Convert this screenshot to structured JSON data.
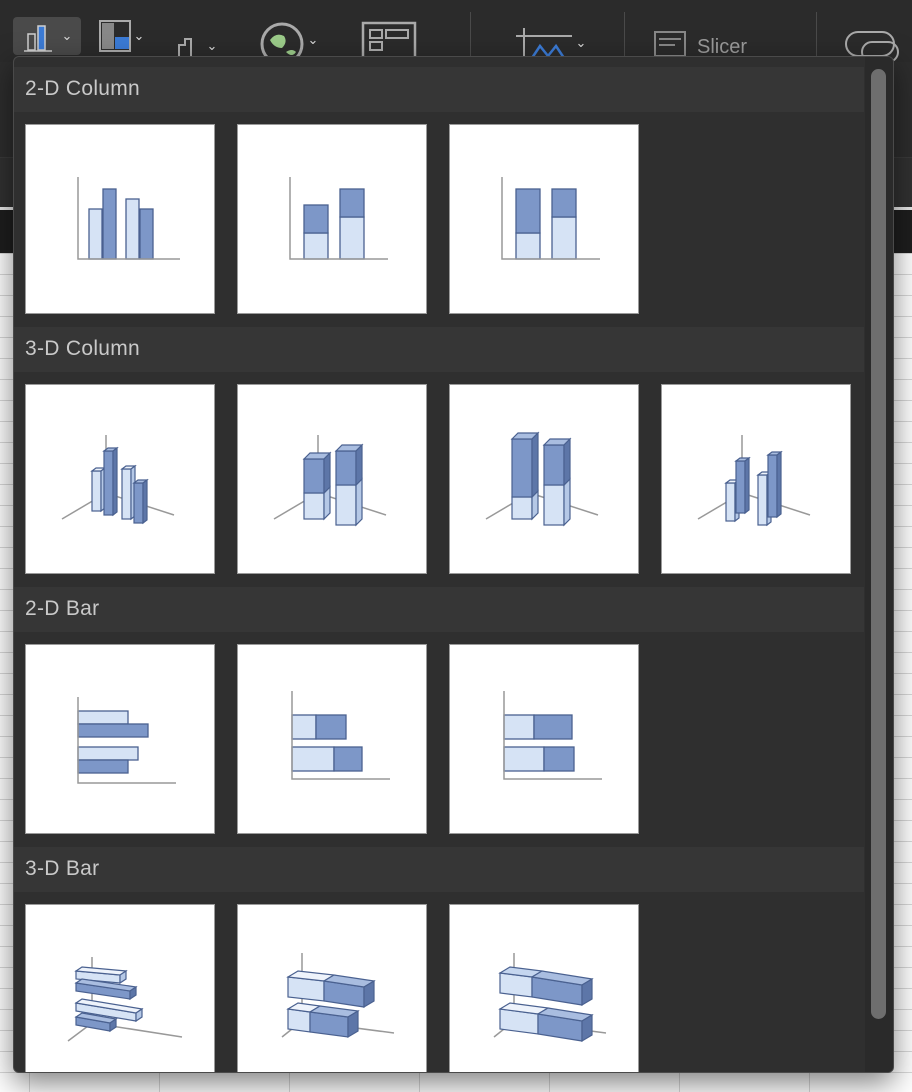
{
  "toolbar": {
    "buttons": [
      {
        "name": "column-chart-button",
        "icon": "column-chart-icon"
      },
      {
        "name": "hierarchy-chart-button",
        "icon": "hierarchy-chart-icon"
      },
      {
        "name": "statistic-chart-button",
        "icon": "statistic-chart-icon"
      },
      {
        "name": "maps-button",
        "icon": "globe-icon"
      },
      {
        "name": "pivotchart-button",
        "icon": "pivotchart-icon"
      },
      {
        "name": "sparklines-button",
        "icon": "sparkline-icon"
      }
    ],
    "slicer_label": "Slicer"
  },
  "dropdown": {
    "sections": [
      {
        "title": "2-D Column",
        "items": [
          "Clustered Column",
          "Stacked Column",
          "100% Stacked Column"
        ]
      },
      {
        "title": "3-D Column",
        "items": [
          "3-D Clustered Column",
          "3-D Stacked Column",
          "3-D 100% Stacked Column",
          "3-D Column"
        ]
      },
      {
        "title": "2-D Bar",
        "items": [
          "Clustered Bar",
          "Stacked Bar",
          "100% Stacked Bar"
        ]
      },
      {
        "title": "3-D Bar",
        "items": [
          "3-D Clustered Bar",
          "3-D Stacked Bar",
          "3-D 100% Stacked Bar"
        ]
      }
    ]
  },
  "colors": {
    "light_fill": "#d6e3f5",
    "dark_fill": "#7d97c8",
    "stroke": "#4a6190",
    "axis": "#999999",
    "panel_bg": "#2f2f2f",
    "header_bg": "#363636"
  }
}
